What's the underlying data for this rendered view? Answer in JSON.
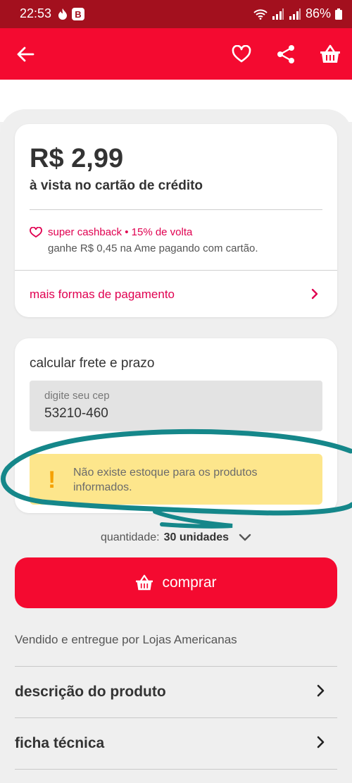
{
  "status_bar": {
    "time": "22:53",
    "battery": "86%"
  },
  "app_bar": {
    "back_icon": "arrow-left-icon",
    "favorite_icon": "heart-outline-icon",
    "share_icon": "share-icon",
    "cart_icon": "basket-icon"
  },
  "price_card": {
    "price": "R$ 2,99",
    "subtitle": "à vista no cartão de crédito",
    "cashback_title": "super cashback • 15% de volta",
    "cashback_sub": "ganhe R$ 0,45 na Ame pagando com cartão.",
    "more_payment": "mais formas de pagamento"
  },
  "shipping_card": {
    "title": "calcular frete e prazo",
    "cep_label": "digite seu cep",
    "cep_value": "53210-460",
    "warning": "Não existe estoque para os produtos informados."
  },
  "quantity": {
    "label": "quantidade:",
    "value": "30 unidades"
  },
  "buy_button": {
    "label": "comprar"
  },
  "seller": "Vendido e entregue por Lojas Americanas",
  "sections": [
    {
      "label": "descrição do produto"
    },
    {
      "label": "ficha técnica"
    }
  ],
  "colors": {
    "brand_red": "#f40a30",
    "status_bar": "#a3101e",
    "accent_pink": "#e00050",
    "warning_bg": "#fde68c",
    "annotation": "#15878a"
  }
}
